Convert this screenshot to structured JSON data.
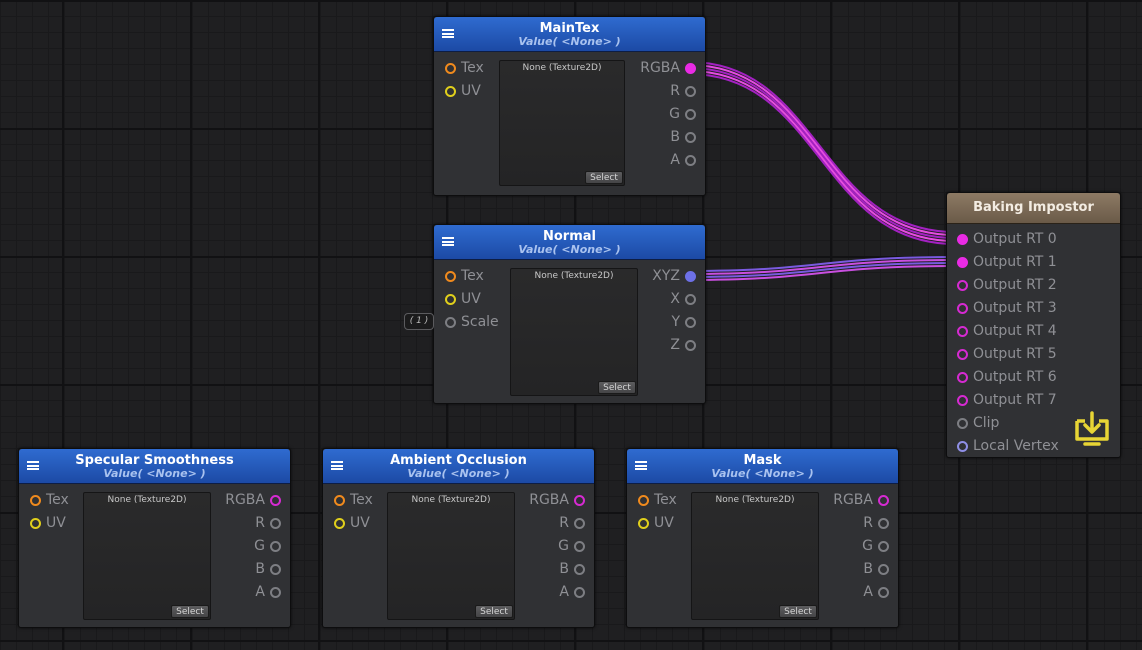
{
  "nodes": {
    "maintex": {
      "title": "MainTex",
      "subtitle": "Value( <None> )",
      "inputs": [
        "Tex",
        "UV"
      ],
      "outputs": [
        "RGBA",
        "R",
        "G",
        "B",
        "A"
      ],
      "preview": "None (Texture2D)",
      "select": "Select"
    },
    "normal": {
      "title": "Normal",
      "subtitle": "Value( <None> )",
      "inputs": [
        "Tex",
        "UV",
        "Scale"
      ],
      "outputs": [
        "XYZ",
        "X",
        "Y",
        "Z"
      ],
      "preview": "None (Texture2D)",
      "select": "Select",
      "scale_value": "( 1 )"
    },
    "specular": {
      "title": "Specular Smoothness",
      "subtitle": "Value( <None> )",
      "inputs": [
        "Tex",
        "UV"
      ],
      "outputs": [
        "RGBA",
        "R",
        "G",
        "B",
        "A"
      ],
      "preview": "None (Texture2D)",
      "select": "Select"
    },
    "ao": {
      "title": "Ambient Occlusion",
      "subtitle": "Value( <None> )",
      "inputs": [
        "Tex",
        "UV"
      ],
      "outputs": [
        "RGBA",
        "R",
        "G",
        "B",
        "A"
      ],
      "preview": "None (Texture2D)",
      "select": "Select"
    },
    "mask": {
      "title": "Mask",
      "subtitle": "Value( <None> )",
      "inputs": [
        "Tex",
        "UV"
      ],
      "outputs": [
        "RGBA",
        "R",
        "G",
        "B",
        "A"
      ],
      "preview": "None (Texture2D)",
      "select": "Select"
    },
    "baking": {
      "title": "Baking Impostor",
      "inputs": [
        "Output RT 0",
        "Output RT 1",
        "Output RT 2",
        "Output RT 3",
        "Output RT 4",
        "Output RT 5",
        "Output RT 6",
        "Output RT 7",
        "Clip",
        "Local Vertex"
      ],
      "icon": "bake-download-icon"
    }
  },
  "colors": {
    "header_blue": "#1c4aa5",
    "header_brown": "#6a5a48",
    "port_magenta": "#e92be4",
    "port_blue": "#6d70e7",
    "port_orange": "#f08a1d",
    "port_yellow": "#e0cf1c",
    "icon_yellow": "#e8d535"
  }
}
